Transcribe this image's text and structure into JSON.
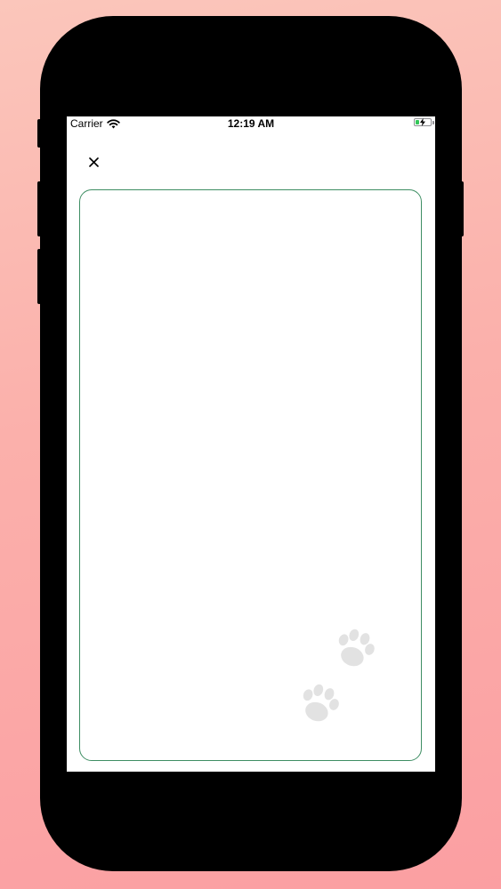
{
  "status_bar": {
    "carrier": "Carrier",
    "time": "12:19 AM",
    "wifi_icon": "wifi-icon",
    "battery_icon": "battery-charging-icon",
    "battery_level": 0.25
  },
  "toolbar": {
    "close_icon": "close-icon"
  },
  "card": {
    "border_color": "#3e8e63",
    "decoration_icon": "paw-print-icon"
  },
  "colors": {
    "background_top": "#fbc6bb",
    "background_bottom": "#fb9fa2",
    "screen": "#ffffff",
    "paw": "#e2e2e2",
    "battery_fill": "#34c759"
  }
}
